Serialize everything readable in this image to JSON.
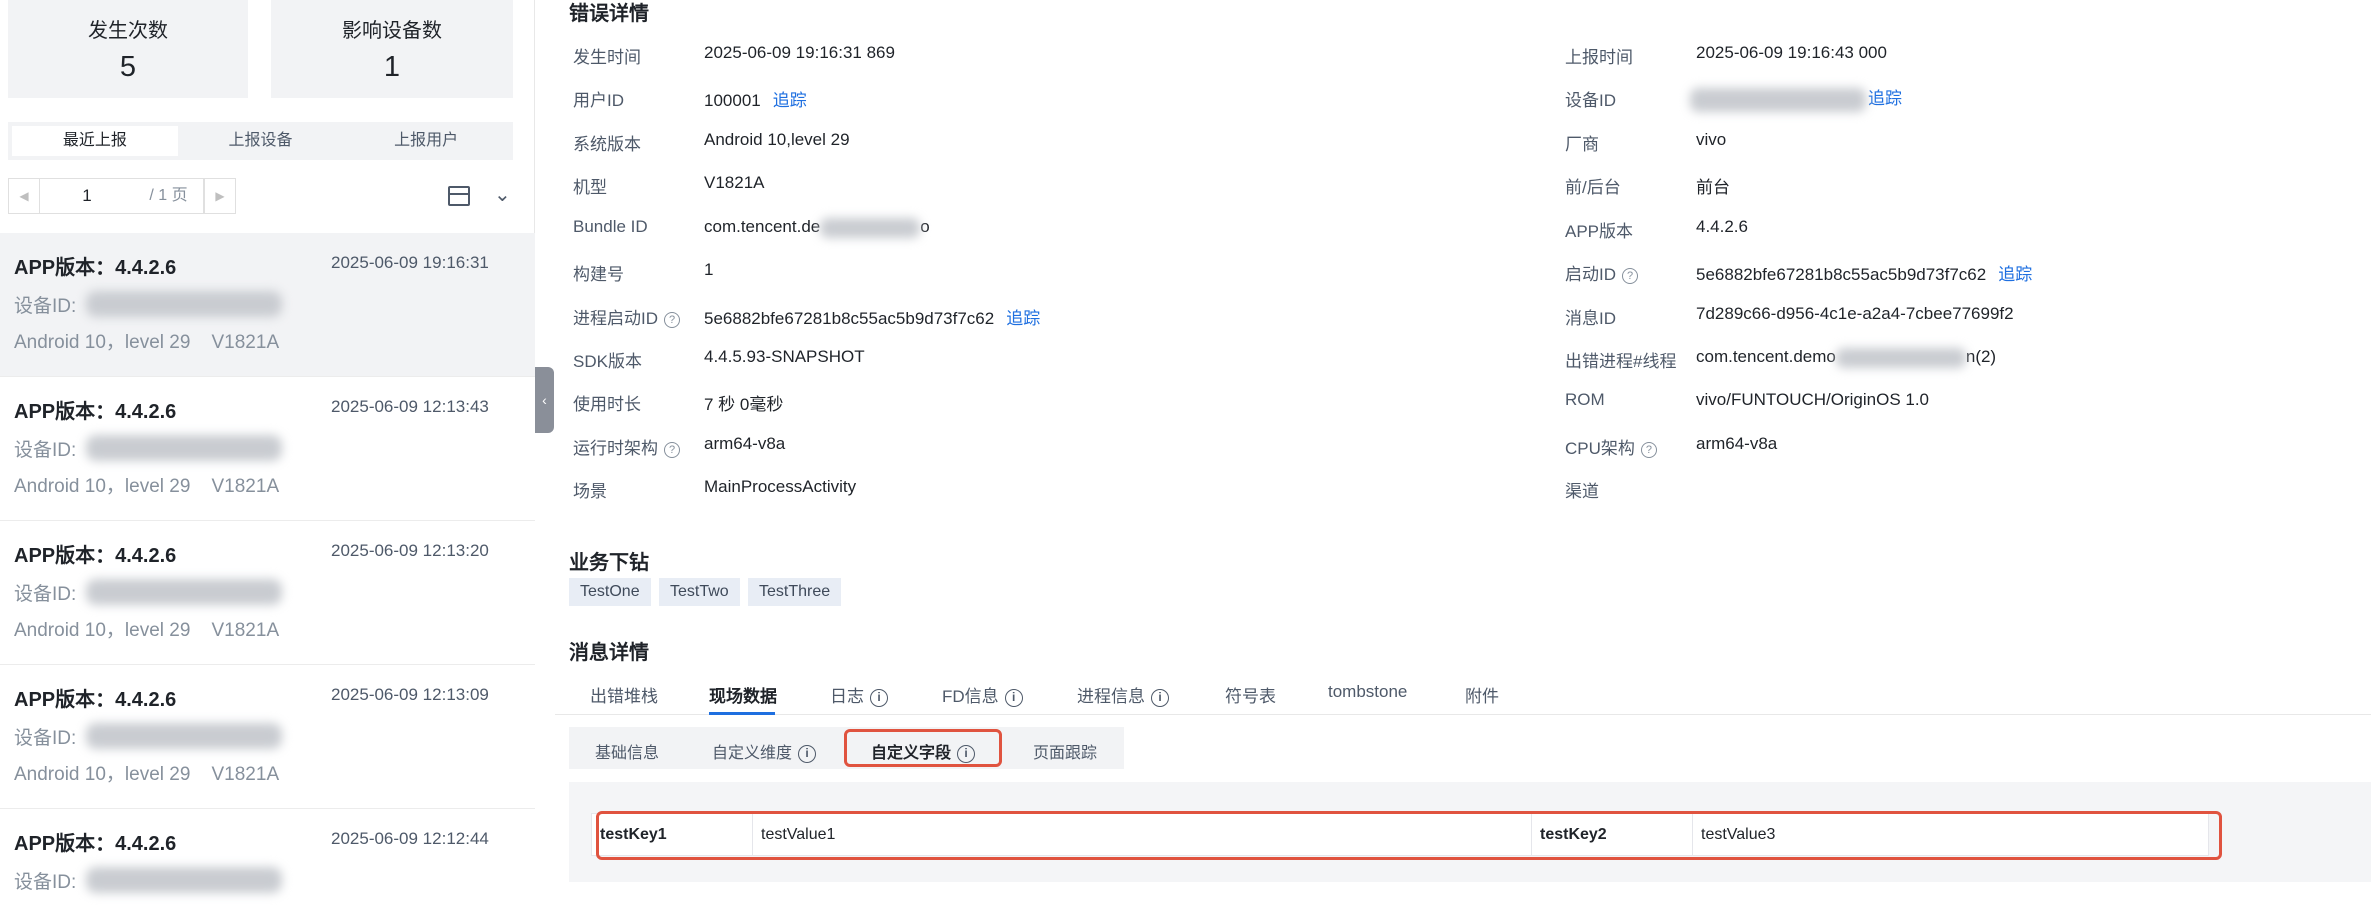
{
  "stats": {
    "occurrences": {
      "label": "发生次数",
      "value": "5"
    },
    "devices": {
      "label": "影响设备数",
      "value": "1"
    }
  },
  "list_tabs": [
    "最近上报",
    "上报设备",
    "上报用户"
  ],
  "pager": {
    "page": "1",
    "total": "/ 1 页"
  },
  "reports": [
    {
      "version": "APP版本：4.4.2.6",
      "time": "2025-06-09 19:16:31",
      "device_label": "设备ID:",
      "system": "Android 10，level 29    V1821A"
    },
    {
      "version": "APP版本：4.4.2.6",
      "time": "2025-06-09 12:13:43",
      "device_label": "设备ID:",
      "system": "Android 10，level 29    V1821A"
    },
    {
      "version": "APP版本：4.4.2.6",
      "time": "2025-06-09 12:13:20",
      "device_label": "设备ID:",
      "system": "Android 10，level 29    V1821A"
    },
    {
      "version": "APP版本：4.4.2.6",
      "time": "2025-06-09 12:13:09",
      "device_label": "设备ID:",
      "system": "Android 10，level 29    V1821A"
    },
    {
      "version": "APP版本：4.4.2.6",
      "time": "2025-06-09 12:12:44",
      "device_label": "设备ID:",
      "system": ""
    }
  ],
  "detail": {
    "title": "错误详情",
    "left": [
      {
        "key": "发生时间",
        "value": "2025-06-09 19:16:31 869"
      },
      {
        "key": "用户ID",
        "value": "100001",
        "link": "追踪"
      },
      {
        "key": "系统版本",
        "value": "Android 10,level 29"
      },
      {
        "key": "机型",
        "value": "V1821A"
      },
      {
        "key": "Bundle ID",
        "value": "com.tencent.de",
        "value_tail": "o"
      },
      {
        "key": "构建号",
        "value": "1"
      },
      {
        "key": "进程启动ID",
        "value": "5e6882bfe67281b8c55ac5b9d73f7c62",
        "link": "追踪"
      },
      {
        "key": "SDK版本",
        "value": "4.4.5.93-SNAPSHOT"
      },
      {
        "key": "使用时长",
        "value": "7 秒 0毫秒"
      },
      {
        "key": "运行时架构",
        "value": "arm64-v8a"
      },
      {
        "key": "场景",
        "value": "MainProcessActivity"
      }
    ],
    "right": [
      {
        "key": "上报时间",
        "value": "2025-06-09 19:16:43 000"
      },
      {
        "key": "设备ID",
        "value": "",
        "link": "追踪"
      },
      {
        "key": "厂商",
        "value": "vivo"
      },
      {
        "key": "前/后台",
        "value": "前台"
      },
      {
        "key": "APP版本",
        "value": "4.4.2.6"
      },
      {
        "key": "启动ID",
        "value": "5e6882bfe67281b8c55ac5b9d73f7c62",
        "link": "追踪"
      },
      {
        "key": "消息ID",
        "value": "7d289c66-d956-4c1e-a2a4-7cbee77699f2"
      },
      {
        "key": "出错进程#线程",
        "value": "com.tencent.demo",
        "value_tail": "n(2)"
      },
      {
        "key": "ROM",
        "value": "vivo/FUNTOUCH/OriginOS 1.0"
      },
      {
        "key": "CPU架构",
        "value": "arm64-v8a"
      },
      {
        "key": "渠道",
        "value": ""
      }
    ],
    "help_glyph": "?"
  },
  "business": {
    "title": "业务下钻",
    "tags": [
      "TestOne",
      "TestTwo",
      "TestThree"
    ]
  },
  "message": {
    "title": "消息详情",
    "tabs": [
      "出错堆栈",
      "现场数据",
      "日志",
      "FD信息",
      "进程信息",
      "符号表",
      "tombstone",
      "附件"
    ],
    "subtabs": [
      "基础信息",
      "自定义维度",
      "自定义字段",
      "页面跟踪"
    ],
    "info_glyph": "i"
  },
  "custom_fields": [
    {
      "key": "testKey1",
      "value": "testValue1"
    },
    {
      "key": "testKey2",
      "value": "testValue3"
    }
  ],
  "icons": {
    "prev": "◀",
    "next": "▶",
    "collapse": "‹",
    "chevron": "⌄"
  },
  "colors": {
    "link": "#1e6fe0",
    "highlight": "#e0533f",
    "active_underline": "#1e6fe0"
  }
}
